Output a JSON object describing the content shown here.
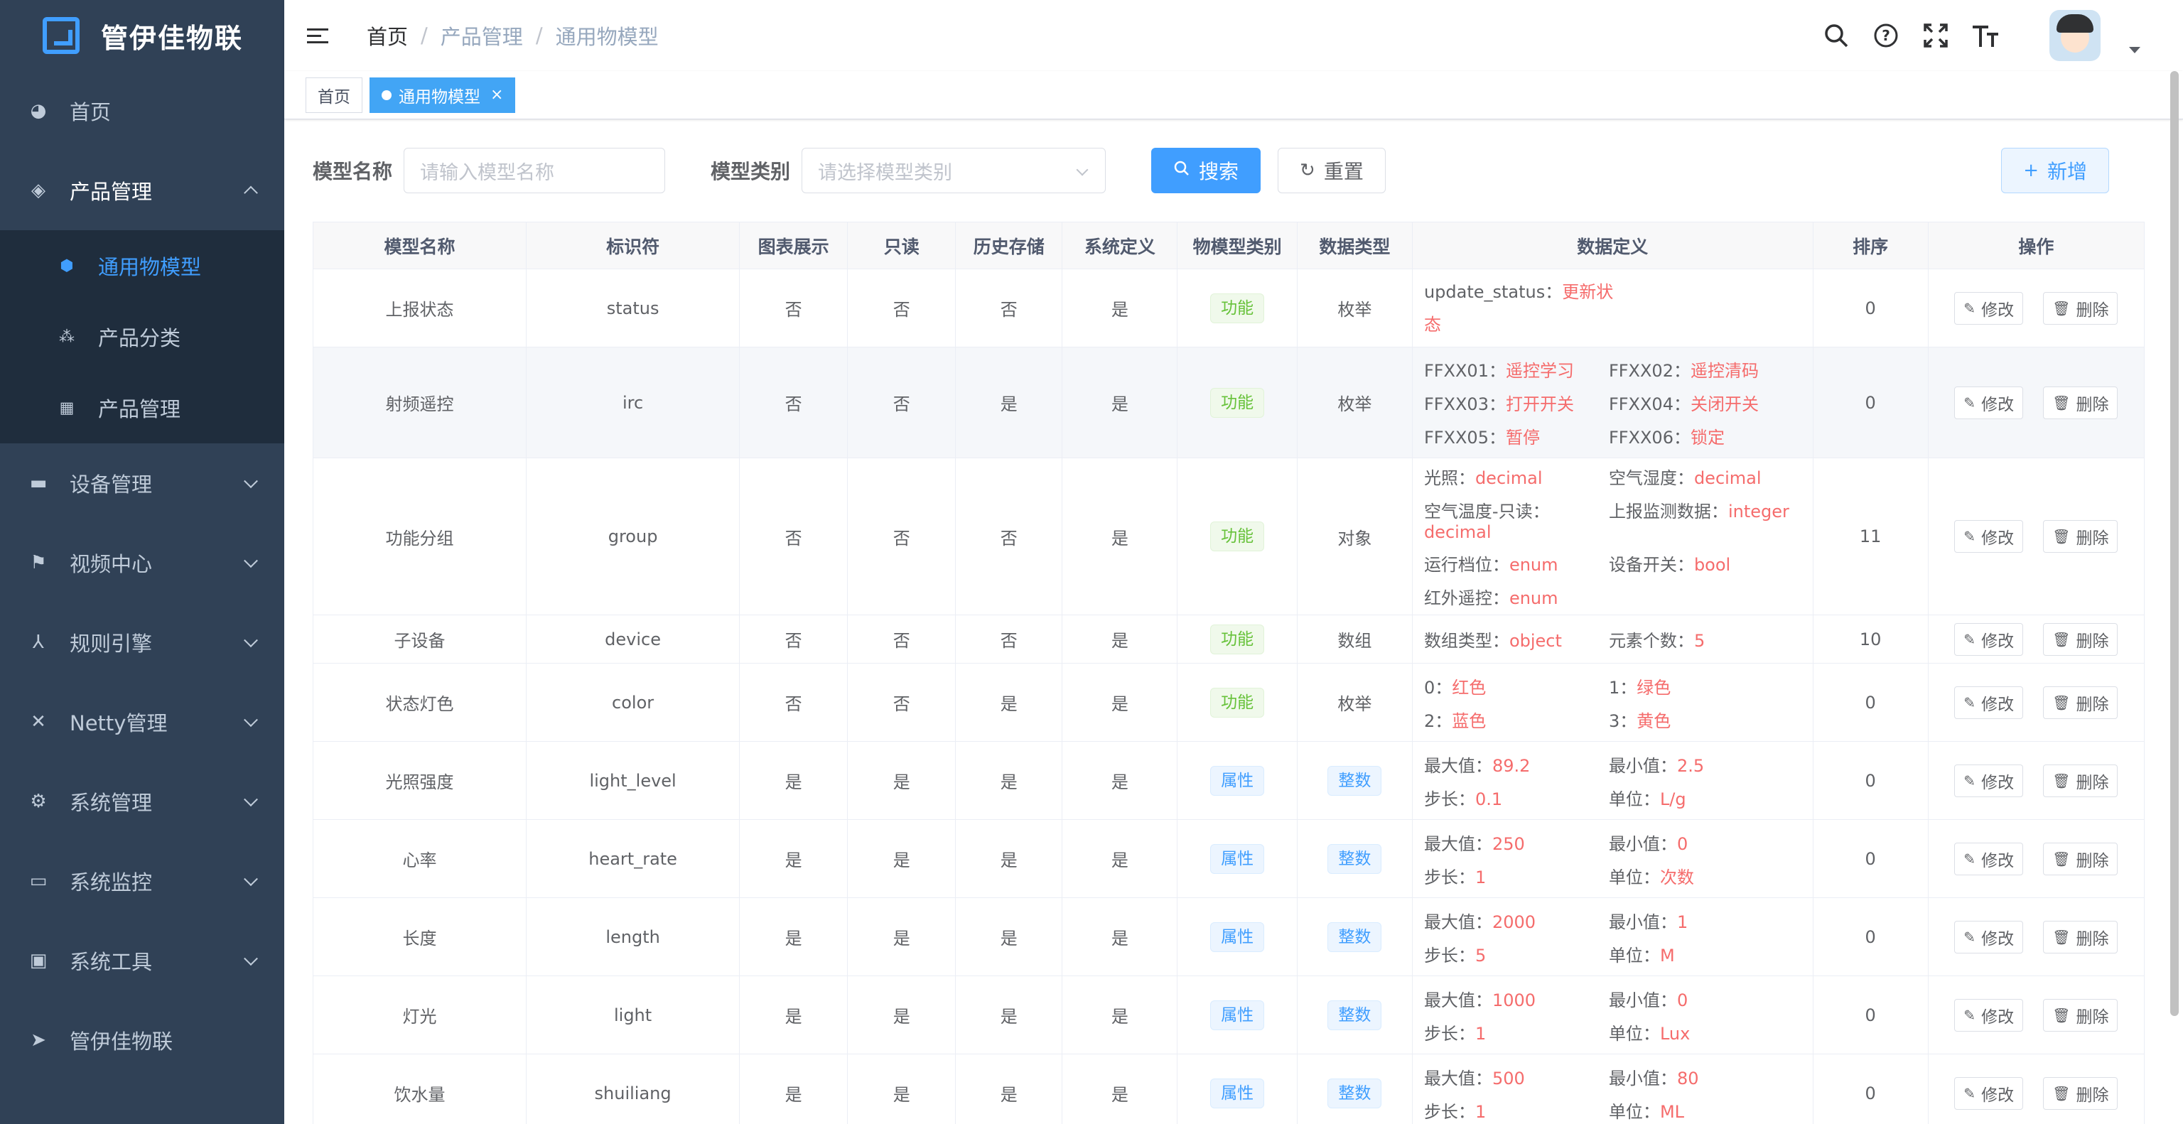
{
  "app": {
    "title": "管伊佳物联"
  },
  "sidebar": {
    "items": [
      {
        "label": "首页",
        "icon": "dashboard-icon"
      },
      {
        "label": "产品管理",
        "icon": "product-icon",
        "expanded": true,
        "children": [
          {
            "label": "通用物模型",
            "icon": "cube-icon",
            "active": true
          },
          {
            "label": "产品分类",
            "icon": "tree-icon"
          },
          {
            "label": "产品管理",
            "icon": "grid-icon"
          }
        ]
      },
      {
        "label": "设备管理",
        "icon": "device-icon"
      },
      {
        "label": "视频中心",
        "icon": "video-icon"
      },
      {
        "label": "规则引擎",
        "icon": "rule-icon"
      },
      {
        "label": "Netty管理",
        "icon": "netty-icon"
      },
      {
        "label": "系统管理",
        "icon": "gear-icon"
      },
      {
        "label": "系统监控",
        "icon": "monitor-icon"
      },
      {
        "label": "系统工具",
        "icon": "toolbox-icon"
      },
      {
        "label": "管伊佳物联",
        "icon": "send-icon"
      }
    ]
  },
  "header": {
    "breadcrumb": [
      "首页",
      "产品管理",
      "通用物模型"
    ],
    "tools": [
      "search-icon",
      "help-icon",
      "fullscreen-icon",
      "font-size-icon"
    ]
  },
  "tags": [
    {
      "label": "首页",
      "active": false
    },
    {
      "label": "通用物模型",
      "active": true
    }
  ],
  "search": {
    "name_label": "模型名称",
    "name_placeholder": "请输入模型名称",
    "type_label": "模型类别",
    "type_placeholder": "请选择模型类别",
    "search_button": "搜索",
    "reset_button": "重置",
    "add_button": "新增"
  },
  "table": {
    "columns": [
      "模型名称",
      "标识符",
      "图表展示",
      "只读",
      "历史存储",
      "系统定义",
      "物模型类别",
      "数据类型",
      "数据定义",
      "排序",
      "操作"
    ],
    "edit_label": "修改",
    "delete_label": "删除",
    "rows": [
      {
        "name": "上报状态",
        "id": "status",
        "chart": "否",
        "readonly": "否",
        "history": "否",
        "system": "是",
        "category": "功能",
        "category_kind": "success",
        "dtype": "枚举",
        "dtype_tag": false,
        "sort": "0",
        "def_single": [
          {
            "k": "update_status：",
            "v": "更新状态"
          }
        ]
      },
      {
        "name": "射频遥控",
        "id": "irc",
        "chart": "否",
        "readonly": "否",
        "history": "是",
        "system": "是",
        "category": "功能",
        "category_kind": "success",
        "dtype": "枚举",
        "dtype_tag": false,
        "sort": "0",
        "def": [
          {
            "k": "FFXX01：",
            "v": "遥控学习"
          },
          {
            "k": "FFXX02：",
            "v": "遥控清码"
          },
          {
            "k": "FFXX03：",
            "v": "打开开关"
          },
          {
            "k": "FFXX04：",
            "v": "关闭开关"
          },
          {
            "k": "FFXX05：",
            "v": "暂停"
          },
          {
            "k": "FFXX06：",
            "v": "锁定"
          }
        ]
      },
      {
        "name": "功能分组",
        "id": "group",
        "chart": "否",
        "readonly": "否",
        "history": "否",
        "system": "是",
        "category": "功能",
        "category_kind": "success",
        "dtype": "对象",
        "dtype_tag": false,
        "sort": "11",
        "def": [
          {
            "k": "光照：",
            "v": "decimal"
          },
          {
            "k": "空气湿度：",
            "v": "decimal"
          },
          {
            "k": "空气温度-只读：",
            "v": "decimal"
          },
          {
            "k": "上报监测数据：",
            "v": "integer"
          },
          {
            "k": "运行档位：",
            "v": "enum"
          },
          {
            "k": "设备开关：",
            "v": "bool"
          },
          {
            "k": "红外遥控：",
            "v": "enum"
          }
        ]
      },
      {
        "name": "子设备",
        "id": "device",
        "chart": "否",
        "readonly": "否",
        "history": "否",
        "system": "是",
        "category": "功能",
        "category_kind": "success",
        "dtype": "数组",
        "dtype_tag": false,
        "sort": "10",
        "def": [
          {
            "k": "数组类型：",
            "v": "object"
          },
          {
            "k": "元素个数：",
            "v": "5"
          }
        ]
      },
      {
        "name": "状态灯色",
        "id": "color",
        "chart": "否",
        "readonly": "否",
        "history": "是",
        "system": "是",
        "category": "功能",
        "category_kind": "success",
        "dtype": "枚举",
        "dtype_tag": false,
        "sort": "0",
        "def": [
          {
            "k": "0：",
            "v": "红色"
          },
          {
            "k": "1：",
            "v": "绿色"
          },
          {
            "k": "2：",
            "v": "蓝色"
          },
          {
            "k": "3：",
            "v": "黄色"
          }
        ]
      },
      {
        "name": "光照强度",
        "id": "light_level",
        "chart": "是",
        "readonly": "是",
        "history": "是",
        "system": "是",
        "category": "属性",
        "category_kind": "primary",
        "dtype": "整数",
        "dtype_tag": true,
        "sort": "0",
        "def": [
          {
            "k": "最大值：",
            "v": "89.2"
          },
          {
            "k": "最小值：",
            "v": "2.5"
          },
          {
            "k": "步长：",
            "v": "0.1"
          },
          {
            "k": "单位：",
            "v": "L/g"
          }
        ]
      },
      {
        "name": "心率",
        "id": "heart_rate",
        "chart": "是",
        "readonly": "是",
        "history": "是",
        "system": "是",
        "category": "属性",
        "category_kind": "primary",
        "dtype": "整数",
        "dtype_tag": true,
        "sort": "0",
        "def": [
          {
            "k": "最大值：",
            "v": "250"
          },
          {
            "k": "最小值：",
            "v": "0"
          },
          {
            "k": "步长：",
            "v": "1"
          },
          {
            "k": "单位：",
            "v": "次数"
          }
        ]
      },
      {
        "name": "长度",
        "id": "length",
        "chart": "是",
        "readonly": "是",
        "history": "是",
        "system": "是",
        "category": "属性",
        "category_kind": "primary",
        "dtype": "整数",
        "dtype_tag": true,
        "sort": "0",
        "def": [
          {
            "k": "最大值：",
            "v": "2000"
          },
          {
            "k": "最小值：",
            "v": "1"
          },
          {
            "k": "步长：",
            "v": "5"
          },
          {
            "k": "单位：",
            "v": "M"
          }
        ]
      },
      {
        "name": "灯光",
        "id": "light",
        "chart": "是",
        "readonly": "是",
        "history": "是",
        "system": "是",
        "category": "属性",
        "category_kind": "primary",
        "dtype": "整数",
        "dtype_tag": true,
        "sort": "0",
        "def": [
          {
            "k": "最大值：",
            "v": "1000"
          },
          {
            "k": "最小值：",
            "v": "0"
          },
          {
            "k": "步长：",
            "v": "1"
          },
          {
            "k": "单位：",
            "v": "Lux"
          }
        ]
      },
      {
        "name": "饮水量",
        "id": "shuiliang",
        "chart": "是",
        "readonly": "是",
        "history": "是",
        "system": "是",
        "category": "属性",
        "category_kind": "primary",
        "dtype": "整数",
        "dtype_tag": true,
        "sort": "0",
        "def": [
          {
            "k": "最大值：",
            "v": "500"
          },
          {
            "k": "最小值：",
            "v": "80"
          },
          {
            "k": "步长：",
            "v": "1"
          },
          {
            "k": "单位：",
            "v": "ML"
          }
        ]
      }
    ]
  }
}
